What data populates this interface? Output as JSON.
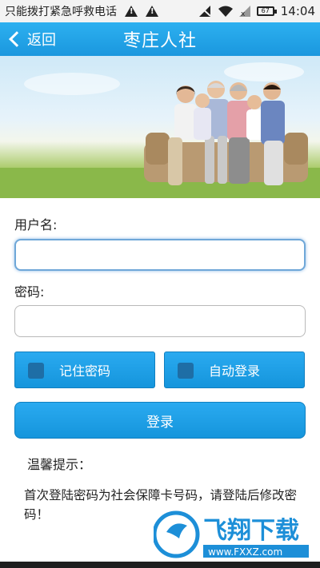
{
  "status_bar": {
    "carrier_text": "只能拨打紧急呼救电话",
    "battery_level": "67",
    "time": "14:04"
  },
  "header": {
    "back_label": "返回",
    "title": "枣庄人社"
  },
  "form": {
    "username_label": "用户名:",
    "username_value": "",
    "password_label": "密码:",
    "password_value": "",
    "remember_label": "记住密码",
    "remember_checked": false,
    "auto_login_label": "自动登录",
    "auto_login_checked": false,
    "login_label": "登录"
  },
  "tips": {
    "title": "温馨提示：",
    "body": "首次登陆密码为社会保障卡号码，请登陆后修改密码！"
  },
  "watermark": {
    "brand": "飞翔下载",
    "url": "www.FXXZ.com"
  },
  "colors": {
    "accent": "#1a9ee4",
    "header": "#1a97de",
    "checkbox": "#1e6ea6",
    "watermark": "#1d8fd8"
  }
}
